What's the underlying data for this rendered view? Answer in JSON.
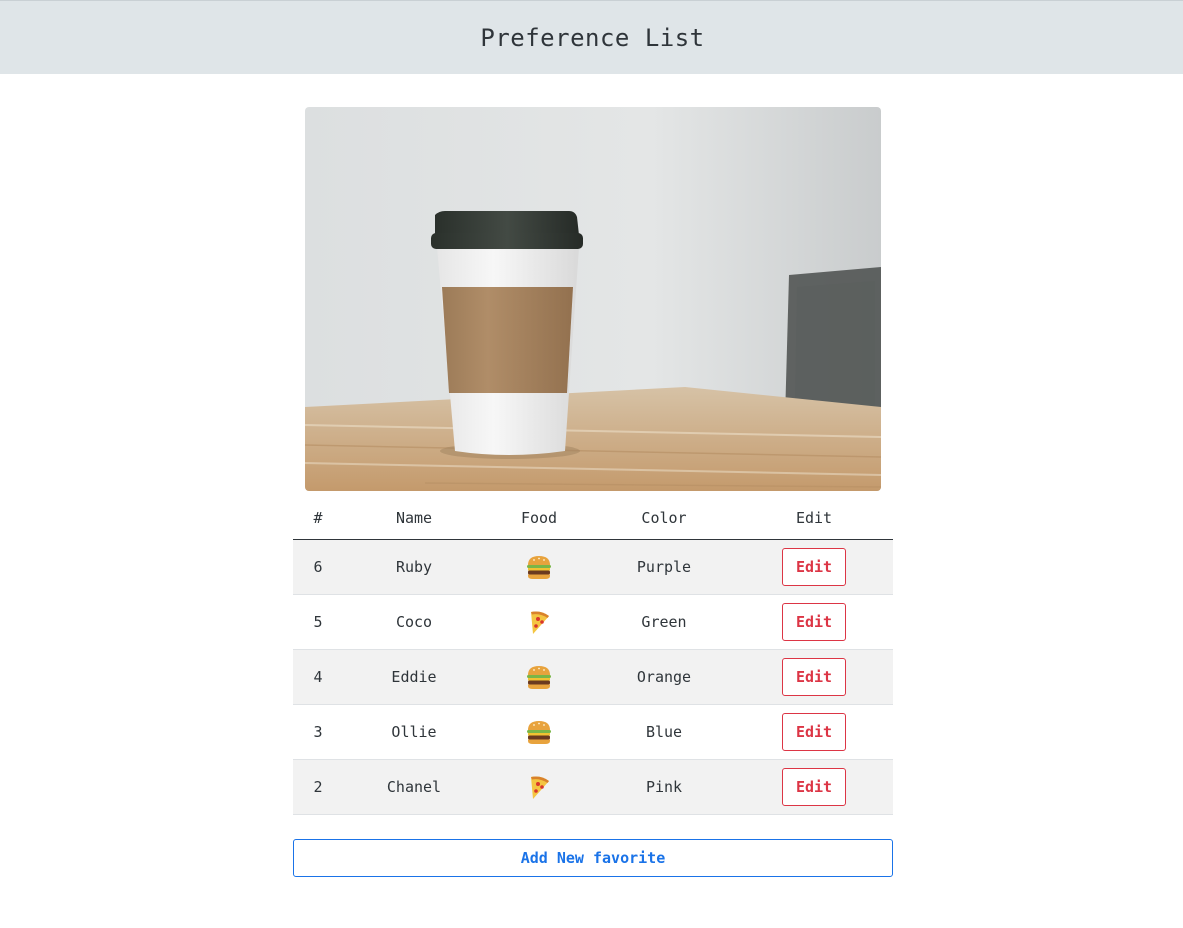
{
  "header": {
    "title": "Preference List"
  },
  "hero_image": {
    "alt": "coffee-cup-photo"
  },
  "table": {
    "columns": [
      "#",
      "Name",
      "Food",
      "Color",
      "Edit"
    ],
    "rows": [
      {
        "id": "6",
        "name": "Ruby",
        "food": "burger-icon",
        "color": "Purple",
        "edit_label": "Edit"
      },
      {
        "id": "5",
        "name": "Coco",
        "food": "pizza-icon",
        "color": "Green",
        "edit_label": "Edit"
      },
      {
        "id": "4",
        "name": "Eddie",
        "food": "burger-icon",
        "color": "Orange",
        "edit_label": "Edit"
      },
      {
        "id": "3",
        "name": "Ollie",
        "food": "burger-icon",
        "color": "Blue",
        "edit_label": "Edit"
      },
      {
        "id": "2",
        "name": "Chanel",
        "food": "pizza-icon",
        "color": "Pink",
        "edit_label": "Edit"
      }
    ]
  },
  "actions": {
    "add_label": "Add New favorite"
  },
  "colors": {
    "topbar": "#dfe5e8",
    "danger": "#dc3545",
    "primary": "#1a73e8",
    "stripe": "#f2f2f2"
  }
}
